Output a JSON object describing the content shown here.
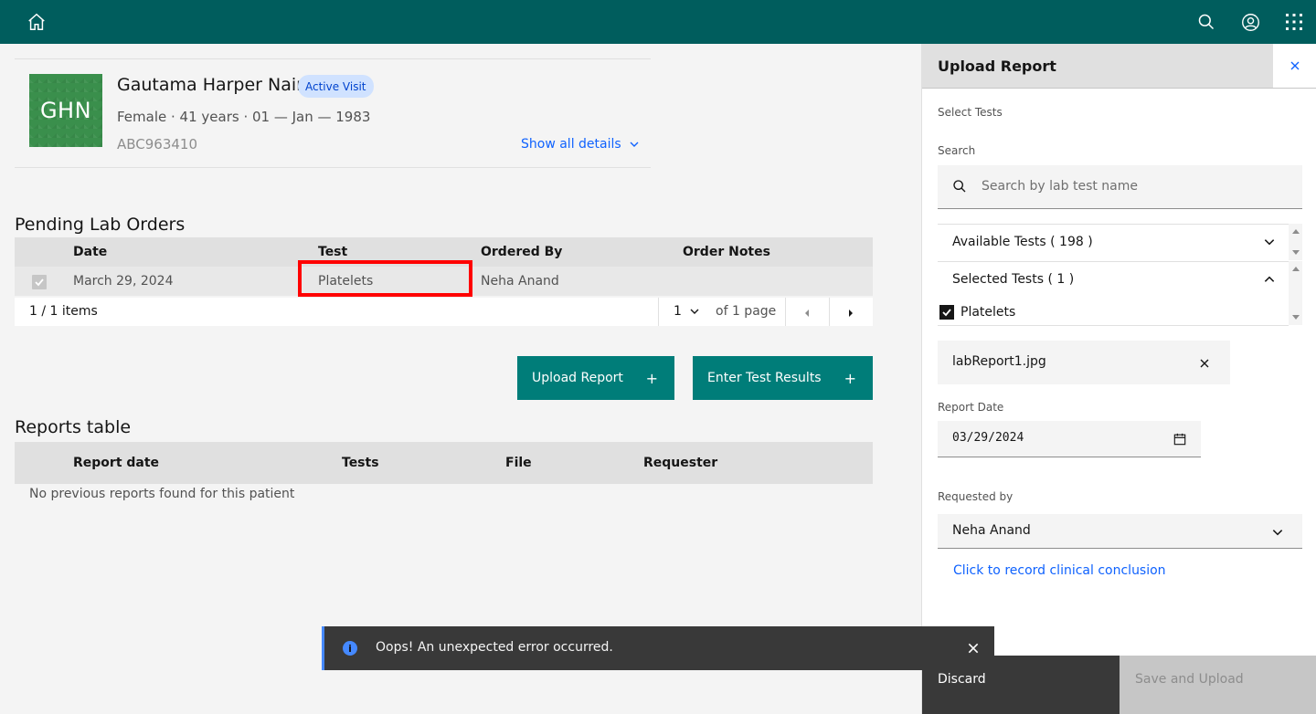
{
  "header": {
    "home_icon": "home-icon",
    "search_icon": "search-icon",
    "user_icon": "user-avatar-icon",
    "apps_icon": "app-switcher-icon",
    "bg_color": "#005d5d"
  },
  "patient": {
    "initials": "GHN",
    "name": "Gautama Harper Nair",
    "visit_tag": "Active Visit",
    "demographics": "Female · 41 years · 01 — Jan — 1983",
    "id": "ABC963410",
    "show_all_label": "Show all details"
  },
  "pending_orders": {
    "title": "Pending Lab Orders",
    "columns": [
      "Date",
      "Test",
      "Ordered By",
      "Order Notes"
    ],
    "rows": [
      {
        "date": "March 29, 2024",
        "test": "Platelets",
        "ordered_by": "Neha Anand",
        "notes": ""
      }
    ],
    "pagination": {
      "items_text": "1 / 1 items",
      "page_value": "1",
      "page_total_text": "of 1 page"
    }
  },
  "actions": {
    "upload_report": "Upload Report",
    "enter_results": "Enter Test Results",
    "plus": "+"
  },
  "reports_table": {
    "title": "Reports table",
    "columns": [
      "Report date",
      "Tests",
      "File",
      "Requester"
    ],
    "empty_message": "No previous reports found for this patient"
  },
  "panel": {
    "title": "Upload Report",
    "select_tests_label": "Select Tests",
    "search_label": "Search",
    "search_placeholder": "Search by lab test name",
    "available_tests": "Available Tests ( 198 )",
    "selected_tests": "Selected Tests ( 1 )",
    "selected_items": [
      "Platelets"
    ],
    "file_name": "labReport1.jpg",
    "report_date_label": "Report Date",
    "report_date_value": "03/29/2024",
    "requested_by_label": "Requested by",
    "requested_by_value": "Neha Anand",
    "clinical_link": "Click to record clinical conclusion",
    "discard": "Discard",
    "save_upload": "Save and Upload"
  },
  "toast": {
    "message": "Oops! An unexpected error occurred.",
    "kind": "info",
    "accent": "#4589ff"
  }
}
